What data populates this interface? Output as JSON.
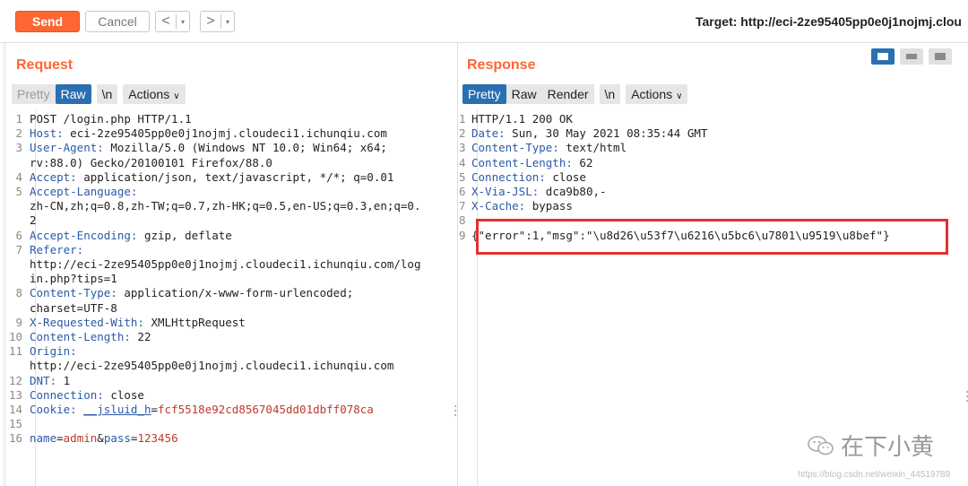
{
  "toolbar": {
    "send_label": "Send",
    "cancel_label": "Cancel",
    "back_arrow": "<",
    "forward_arrow": ">",
    "dropdown_glyph": "▾",
    "target_text": "Target: http://eci-2ze95405pp0e0j1nojmj.clou"
  },
  "request": {
    "title": "Request",
    "tabs": [
      "Pretty",
      "Raw",
      "\\n",
      "Actions"
    ],
    "lines": [
      {
        "n": "1",
        "k": "",
        "v": "POST /login.php HTTP/1.1"
      },
      {
        "n": "2",
        "k": "Host:",
        "v": " eci-2ze95405pp0e0j1nojmj.cloudeci1.ichunqiu.com"
      },
      {
        "n": "3",
        "k": "User-Agent:",
        "v": " Mozilla/5.0 (Windows NT 10.0; Win64; x64;"
      },
      {
        "n": "",
        "k": "",
        "v": "rv:88.0) Gecko/20100101 Firefox/88.0"
      },
      {
        "n": "4",
        "k": "Accept:",
        "v": " application/json, text/javascript, */*; q=0.01"
      },
      {
        "n": "5",
        "k": "Accept-Language:",
        "v": ""
      },
      {
        "n": "",
        "k": "",
        "v": "zh-CN,zh;q=0.8,zh-TW;q=0.7,zh-HK;q=0.5,en-US;q=0.3,en;q=0."
      },
      {
        "n": "",
        "k": "",
        "v": "2"
      },
      {
        "n": "6",
        "k": "Accept-Encoding:",
        "v": " gzip, deflate"
      },
      {
        "n": "7",
        "k": "Referer:",
        "v": ""
      },
      {
        "n": "",
        "k": "",
        "v": "http://eci-2ze95405pp0e0j1nojmj.cloudeci1.ichunqiu.com/log"
      },
      {
        "n": "",
        "k": "",
        "v": "in.php?tips=1"
      },
      {
        "n": "8",
        "k": "Content-Type:",
        "v": " application/x-www-form-urlencoded;"
      },
      {
        "n": "",
        "k": "",
        "v": "charset=UTF-8"
      },
      {
        "n": "9",
        "k": "X-Requested-With:",
        "v": " XMLHttpRequest"
      },
      {
        "n": "10",
        "k": "Content-Length:",
        "v": " 22"
      },
      {
        "n": "11",
        "k": "Origin:",
        "v": ""
      },
      {
        "n": "",
        "k": "",
        "v": "http://eci-2ze95405pp0e0j1nojmj.cloudeci1.ichunqiu.com"
      },
      {
        "n": "12",
        "k": "DNT:",
        "v": " 1"
      },
      {
        "n": "13",
        "k": "Connection:",
        "v": " close"
      },
      {
        "n": "14",
        "k": "Cookie:",
        "v": " __jsluid_h=fcf5518e92cd8567045dd01dbff078ca"
      },
      {
        "n": "15",
        "k": "",
        "v": ""
      },
      {
        "n": "16",
        "k": "",
        "v": "name=admin&pass=123456"
      }
    ]
  },
  "response": {
    "title": "Response",
    "tabs": [
      "Pretty",
      "Raw",
      "Render",
      "\\n",
      "Actions"
    ],
    "lines": [
      {
        "n": "1",
        "k": "",
        "v": "HTTP/1.1 200 OK"
      },
      {
        "n": "2",
        "k": "Date:",
        "v": " Sun, 30 May 2021 08:35:44 GMT"
      },
      {
        "n": "3",
        "k": "Content-Type:",
        "v": " text/html"
      },
      {
        "n": "4",
        "k": "Content-Length:",
        "v": " 62"
      },
      {
        "n": "5",
        "k": "Connection:",
        "v": " close"
      },
      {
        "n": "6",
        "k": "X-Via-JSL:",
        "v": " dca9b80,-"
      },
      {
        "n": "7",
        "k": "X-Cache:",
        "v": " bypass"
      },
      {
        "n": "8",
        "k": "",
        "v": ""
      },
      {
        "n": "9",
        "k": "",
        "v": "{\"error\":1,\"msg\":\"\\u8d26\\u53f7\\u6216\\u5bc6\\u7801\\u9519\\u8bef\"}"
      }
    ]
  },
  "watermark": {
    "text": "在下小黄",
    "url": "https://blog.csdn.net/weixin_44519789"
  },
  "colors": {
    "accent": "#ff6633",
    "tab_active": "#2a6fb1",
    "highlight_box": "#e23030"
  }
}
